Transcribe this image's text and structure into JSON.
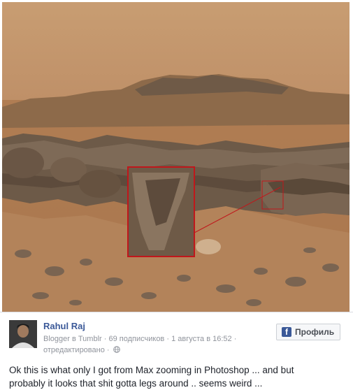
{
  "post": {
    "author_name": "Rahul Raj",
    "author_role": "Blogger в Tumblr",
    "separator_1": "·",
    "followers": "69 подписчиков",
    "separator_2": "·",
    "timestamp": "1 августа в 16:52",
    "separator_3": "·",
    "edited": "отредактировано",
    "separator_4": "·",
    "text_line_1": "Ok this is what only I got from Max zooming in Photoshop ... and but",
    "text_line_2": "probably it looks that shit gotta legs around .. seems weird ..."
  },
  "profile_button": {
    "icon_letter": "f",
    "label": "Профиль"
  },
  "colors": {
    "link_blue": "#3b5998",
    "meta_gray": "#90949c",
    "highlight_red": "#c0171b",
    "terrain": "#b98a5e"
  },
  "icons": {
    "privacy": "globe-icon",
    "profile": "facebook-icon"
  }
}
